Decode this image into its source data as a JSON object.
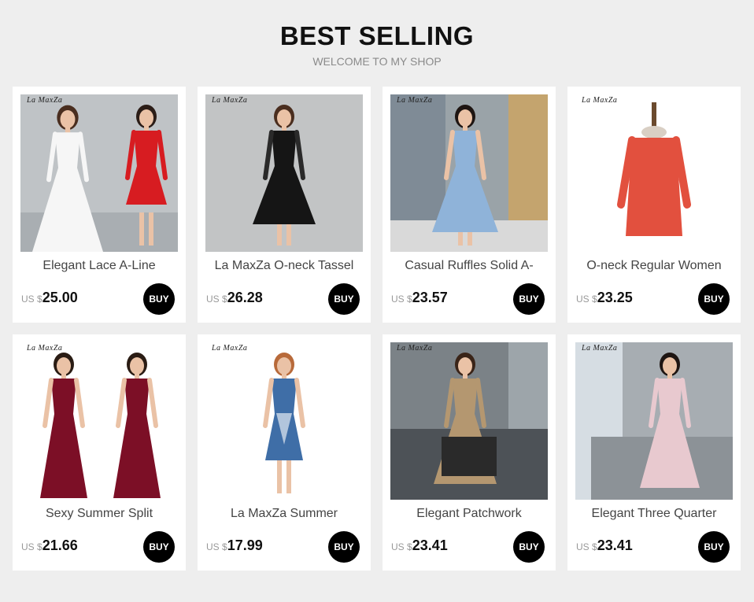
{
  "header": {
    "title": "BEST SELLING",
    "subtitle": "WELCOME TO MY SHOP"
  },
  "buy_label": "BUY",
  "products": [
    {
      "name": "Elegant Lace A-Line",
      "currency": "US $",
      "price": "25.00",
      "brand": "La MaxZa",
      "image": "white-lace-and-red-dresses",
      "bg": "#bfc3c6",
      "dress": "#f6f6f6",
      "dress2": "#d71c21"
    },
    {
      "name": "La MaxZa O-neck Tassel",
      "currency": "US $",
      "price": "26.28",
      "brand": "La MaxZa",
      "image": "black-tassel-dress",
      "bg": "#c7c9ca",
      "dress": "#151515"
    },
    {
      "name": "Casual Ruffles Solid A-",
      "currency": "US $",
      "price": "23.57",
      "brand": "La MaxZa",
      "image": "blue-ruffle-dress",
      "bg": "#9aa3a8",
      "dress": "#8fb3d9"
    },
    {
      "name": "O-neck Regular Women",
      "currency": "US $",
      "price": "23.25",
      "brand": "La MaxZa",
      "image": "red-lace-dress-on-mannequin",
      "bg": "#ffffff",
      "dress": "#e2503e"
    },
    {
      "name": "Sexy Summer Split",
      "currency": "US $",
      "price": "21.66",
      "brand": "La MaxZa",
      "image": "wine-red-maxi-dress",
      "bg": "#ffffff",
      "dress": "#7c0f26"
    },
    {
      "name": "La MaxZa Summer",
      "currency": "US $",
      "price": "17.99",
      "brand": "La MaxZa",
      "image": "printed-halter-dress",
      "bg": "#ffffff",
      "dress": "#3f6ea7"
    },
    {
      "name": "Elegant Patchwork",
      "currency": "US $",
      "price": "23.41",
      "brand": "La MaxZa",
      "image": "striped-blouse-dress",
      "bg": "#7b8287",
      "dress": "#b49770"
    },
    {
      "name": "Elegant Three Quarter",
      "currency": "US $",
      "price": "23.41",
      "brand": "La MaxZa",
      "image": "pink-lace-dress",
      "bg": "#a7adb2",
      "dress": "#e8c9cf"
    }
  ]
}
